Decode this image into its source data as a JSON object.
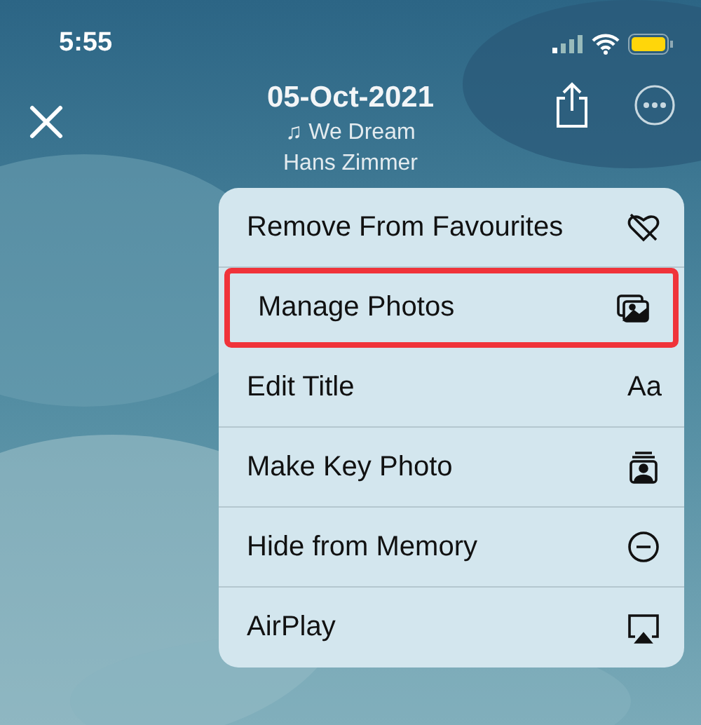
{
  "status_bar": {
    "time": "5:55"
  },
  "header": {
    "title": "05-Oct-2021",
    "song": "We Dream",
    "artist": "Hans Zimmer",
    "song_glyph": "♫"
  },
  "menu": [
    {
      "label": "Remove From Favourites",
      "highlighted": false
    },
    {
      "label": "Manage Photos",
      "highlighted": true
    },
    {
      "label": "Edit Title",
      "icon_text": "Aa",
      "highlighted": false
    },
    {
      "label": "Make Key Photo",
      "highlighted": false
    },
    {
      "label": "Hide from Memory",
      "highlighted": false
    },
    {
      "label": "AirPlay",
      "highlighted": false
    }
  ]
}
